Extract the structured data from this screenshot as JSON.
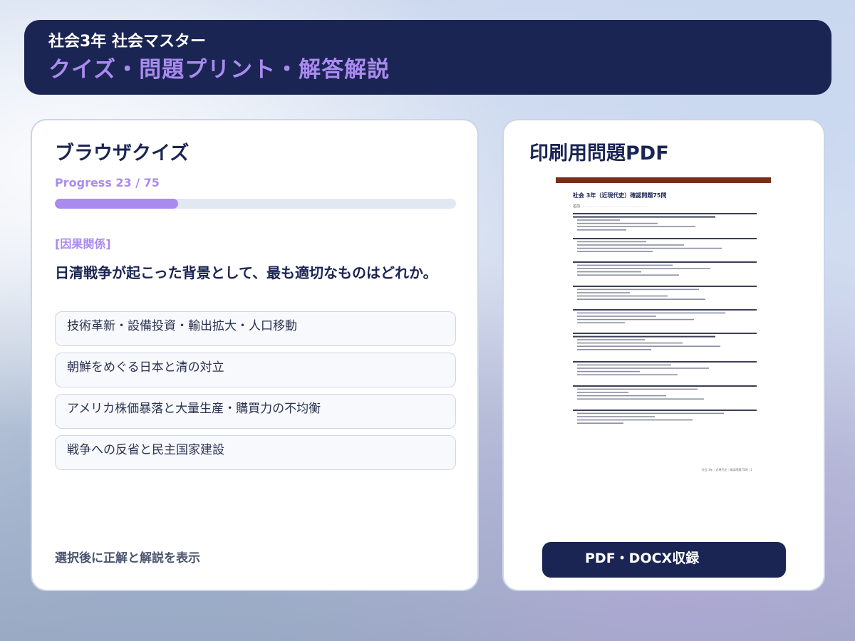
{
  "header": {
    "subtitle": "社会3年 社会マスター",
    "title": "クイズ・問題プリント・解答解説"
  },
  "quiz": {
    "title": "ブラウザクイズ",
    "progress_label": "Progress  23 / 75",
    "progress_fraction": 0.307,
    "category": "[因果関係]",
    "question": "日清戦争が起こった背景として、最も適切なものはどれか。",
    "options": [
      "技術革新・設備投資・輸出拡大・人口移動",
      "朝鮮をめぐる日本と清の対立",
      "アメリカ株価暴落と大量生産・購買力の不均衡",
      "戦争への反省と民主国家建設"
    ],
    "footer_note": "選択後に正解と解説を表示"
  },
  "pdf": {
    "title": "印刷用問題PDF",
    "doc_title": "社会 3年（近現代史）確認問題75問",
    "name_line": "名前：",
    "footer": "社会 3年｜近現代史｜確認問題75問｜1",
    "button_label": "PDF・DOCX収録"
  },
  "colors": {
    "navy": "#1b2553",
    "accent_purple": "#a98bf0",
    "pdf_rule": "#7a2e16"
  }
}
